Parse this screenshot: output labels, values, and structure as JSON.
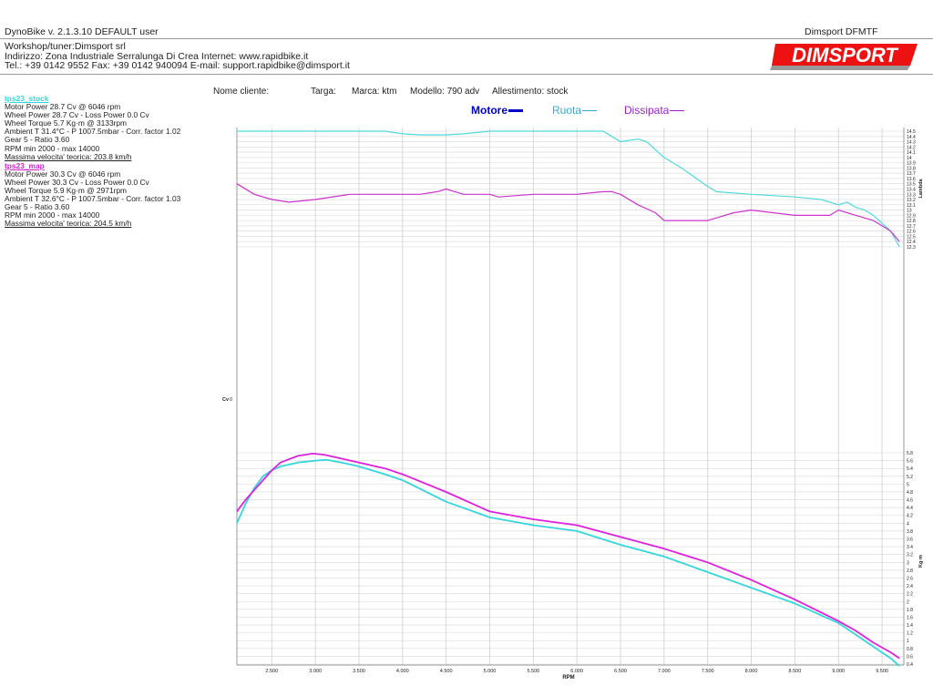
{
  "header": {
    "app_title": "DynoBike v. 2.1.3.10   DEFAULT user",
    "device": "Dimsport DFMTF"
  },
  "company": {
    "line1": "Workshop/tuner:Dimsport srl",
    "line2": "Indirizzo: Zona Industriale Serralunga Di Crea Internet: www.rapidbike.it",
    "line3": "Tel.: +39 0142 9552 Fax: +39 0142 940094 E-mail: support.rapidbike@dimsport.it"
  },
  "logo": {
    "text": "DIMSPORT"
  },
  "runs": [
    {
      "name": "tps23_stock",
      "color": "#33d6dd",
      "lines": [
        "Motor Power 28.7 Cv  @ 6046 rpm",
        "Wheel Power 28.7 Cv  - Loss Power 0.0 Cv",
        "Wheel Torque 5.7 Kg·m  @ 3133rpm",
        "Ambient T 31.4°C - P 1007.5mbar - Corr. factor 1.02",
        "Gear 5 - Ratio 3.60",
        "RPM min 2000 - max 14000"
      ],
      "speed": "Massima velocita' teorica: 203.8 km/h"
    },
    {
      "name": "tps23_map",
      "color": "#cc22cc",
      "lines": [
        "Motor Power 30.3 Cv  @ 6046 rpm",
        "Wheel Power 30.3 Cv  - Loss Power 0.0 Cv",
        "Wheel Torque 5.9 Kg·m  @ 2971rpm",
        "Ambient T 32.6°C - P 1007.5mbar - Corr. factor 1.03",
        "Gear 5 - Ratio 3.60",
        "RPM min 2000 - max 14000"
      ],
      "speed": "Massima velocita' teorica: 204.5 km/h"
    }
  ],
  "info": {
    "cliente": "Nome cliente:",
    "targa": "Targa:",
    "marca": "Marca: ktm",
    "modello": "Modello: 790 adv",
    "allestimento": "Allestimento: stock"
  },
  "legend": {
    "motore": "Motore",
    "ruota": "Ruota",
    "dissipata": "Dissipata",
    "motore_color": "#0000cc",
    "ruota_color": "#33aadd",
    "dissipata_color": "#9922cc"
  },
  "chart_data": {
    "type": "line",
    "x_label": "RPM",
    "x_ticks": [
      2500,
      3000,
      3500,
      4000,
      4500,
      5000,
      5500,
      6000,
      6500,
      7000,
      7500,
      8000,
      8500,
      9000,
      9500
    ],
    "xlim": [
      2100,
      9750
    ],
    "power_axis": {
      "label": "Cv",
      "ticks": [
        0
      ]
    },
    "lambda_axis": {
      "label": "Lambda",
      "range": [
        12.3,
        14.5
      ],
      "ticks": [
        14.5,
        14.4,
        14.3,
        14.2,
        14.1,
        14,
        13.9,
        13.8,
        13.7,
        13.6,
        13.5,
        13.4,
        13.3,
        13.2,
        13.1,
        13,
        12.9,
        12.8,
        12.7,
        12.6,
        12.5,
        12.4,
        12.3
      ]
    },
    "torque_axis": {
      "label": "Kg·m",
      "range": [
        0.4,
        5.8
      ],
      "ticks": [
        5.8,
        5.6,
        5.4,
        5.2,
        5,
        4.8,
        4.6,
        4.4,
        4.2,
        4,
        3.8,
        3.6,
        3.4,
        3.2,
        3,
        2.8,
        2.6,
        2.4,
        2.2,
        2,
        1.8,
        1.6,
        1.4,
        1.2,
        1,
        0.8,
        0.6,
        0.4
      ]
    },
    "series": [
      {
        "name": "tps23_stock",
        "quantity": "lambda",
        "color": "#4fd9dc",
        "x": [
          2100,
          3200,
          3600,
          3800,
          4000,
          4200,
          4500,
          4700,
          5000,
          6000,
          6300,
          6400,
          6500,
          6700,
          6800,
          7000,
          7200,
          7500,
          7600,
          8000,
          8500,
          8800,
          9000,
          9100,
          9200,
          9300,
          9400,
          9500,
          9600,
          9700
        ],
        "y": [
          14.5,
          14.5,
          14.5,
          14.5,
          14.45,
          14.43,
          14.43,
          14.45,
          14.5,
          14.5,
          14.5,
          14.4,
          14.3,
          14.35,
          14.3,
          14.0,
          13.8,
          13.45,
          13.35,
          13.3,
          13.25,
          13.2,
          13.1,
          13.15,
          13.05,
          13.0,
          12.9,
          12.75,
          12.6,
          12.3
        ]
      },
      {
        "name": "tps23_map",
        "quantity": "lambda",
        "color": "#cc33cc",
        "x": [
          2100,
          2300,
          2500,
          2700,
          3000,
          3400,
          3800,
          4000,
          4200,
          4400,
          4500,
          4600,
          4700,
          5000,
          5100,
          5500,
          6000,
          6300,
          6400,
          6500,
          6700,
          6900,
          7000,
          7500,
          7800,
          8000,
          8500,
          8900,
          9000,
          9100,
          9200,
          9400,
          9500,
          9600,
          9700
        ],
        "y": [
          13.5,
          13.3,
          13.2,
          13.15,
          13.2,
          13.3,
          13.3,
          13.3,
          13.3,
          13.35,
          13.4,
          13.35,
          13.3,
          13.3,
          13.25,
          13.3,
          13.3,
          13.35,
          13.35,
          13.3,
          13.1,
          12.95,
          12.8,
          12.8,
          12.95,
          13.0,
          12.9,
          12.9,
          13.0,
          12.95,
          12.9,
          12.8,
          12.7,
          12.6,
          12.4
        ]
      },
      {
        "name": "tps23_stock",
        "quantity": "torque",
        "color": "#33d6dd",
        "x": [
          2100,
          2200,
          2300,
          2400,
          2500,
          2600,
          2800,
          3000,
          3133,
          3300,
          3500,
          3800,
          4000,
          4500,
          5000,
          5500,
          6000,
          6500,
          7000,
          7500,
          8000,
          8500,
          9000,
          9200,
          9400,
          9600,
          9700
        ],
        "y": [
          4.0,
          4.5,
          4.9,
          5.2,
          5.35,
          5.45,
          5.55,
          5.6,
          5.62,
          5.55,
          5.45,
          5.25,
          5.1,
          4.55,
          4.15,
          3.95,
          3.8,
          3.45,
          3.15,
          2.75,
          2.35,
          1.95,
          1.45,
          1.15,
          0.85,
          0.55,
          0.35
        ]
      },
      {
        "name": "tps23_map",
        "quantity": "torque",
        "color": "#dd22dd",
        "x": [
          2100,
          2200,
          2300,
          2400,
          2500,
          2600,
          2800,
          2971,
          3100,
          3300,
          3500,
          3800,
          4000,
          4500,
          5000,
          5500,
          6000,
          6500,
          7000,
          7500,
          8000,
          8500,
          9000,
          9200,
          9400,
          9600,
          9700
        ],
        "y": [
          4.3,
          4.6,
          4.85,
          5.1,
          5.35,
          5.55,
          5.72,
          5.78,
          5.75,
          5.65,
          5.55,
          5.4,
          5.25,
          4.8,
          4.3,
          4.1,
          3.95,
          3.65,
          3.35,
          3.0,
          2.55,
          2.05,
          1.5,
          1.25,
          0.95,
          0.7,
          0.55
        ]
      }
    ]
  }
}
